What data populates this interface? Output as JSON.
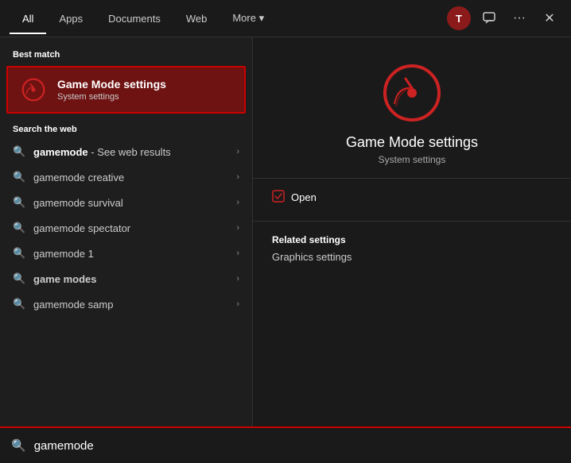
{
  "header": {
    "tabs": [
      {
        "id": "all",
        "label": "All",
        "active": true
      },
      {
        "id": "apps",
        "label": "Apps",
        "active": false
      },
      {
        "id": "documents",
        "label": "Documents",
        "active": false
      },
      {
        "id": "web",
        "label": "Web",
        "active": false
      },
      {
        "id": "more",
        "label": "More ▾",
        "active": false
      }
    ],
    "user_initial": "T",
    "action_dots": "···",
    "close": "✕"
  },
  "left": {
    "best_match_label": "Best match",
    "best_match": {
      "title": "Game Mode settings",
      "subtitle": "System settings"
    },
    "search_web_label": "Search the web",
    "search_items": [
      {
        "text": "gamemode",
        "suffix": " - See web results",
        "bold": true
      },
      {
        "text": "gamemode creative",
        "suffix": "",
        "bold": false
      },
      {
        "text": "gamemode survival",
        "suffix": "",
        "bold": false
      },
      {
        "text": "gamemode spectator",
        "suffix": "",
        "bold": false
      },
      {
        "text": "gamemode 1",
        "suffix": "",
        "bold": false
      },
      {
        "text": "game modes",
        "suffix": "",
        "bold": false
      },
      {
        "text": "gamemode samp",
        "suffix": "",
        "bold": false
      }
    ]
  },
  "right": {
    "title": "Game Mode settings",
    "subtitle": "System settings",
    "open_label": "Open",
    "related_settings_label": "Related settings",
    "related_links": [
      "Graphics settings"
    ]
  },
  "searchbar": {
    "value": "gamemode",
    "placeholder": "gamemode"
  }
}
